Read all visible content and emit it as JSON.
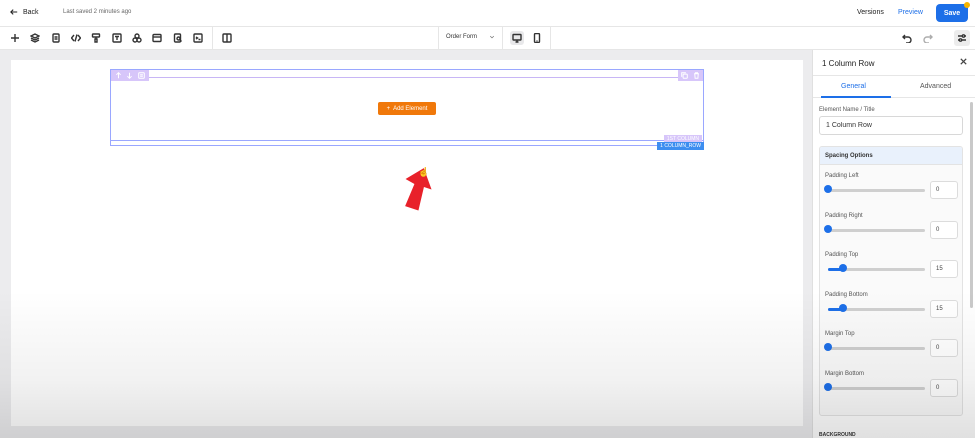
{
  "topbar": {
    "back_label": "Back",
    "saved_status": "Last saved 2 minutes ago",
    "versions_label": "Versions",
    "preview_label": "Preview",
    "save_label": "Save"
  },
  "toolbar": {
    "icons": [
      "plus-icon",
      "layers-icon",
      "forms-icon",
      "paint-roller-icon",
      "code-icon",
      "text-icon",
      "shapes-icon",
      "layout-icon",
      "search-file-icon",
      "terminal-icon",
      "columns-icon"
    ],
    "form_selector": "Order Form",
    "devices": [
      "desktop-icon",
      "mobile-icon"
    ],
    "right_icons": [
      "undo-icon",
      "redo-icon",
      "settings-sliders-icon"
    ]
  },
  "canvas": {
    "add_element_label": "Add Element",
    "column_tag": "1ST COLUMN",
    "row_tag": "1 COLUMN_ROW"
  },
  "panel": {
    "title": "1 Column Row",
    "tabs": [
      "General",
      "Advanced"
    ],
    "active_tab": "General",
    "element_name_label": "Element Name / Title",
    "element_name_value": "1 Column Row",
    "spacing_title": "Spacing Options",
    "sliders": [
      {
        "label": "Padding Left",
        "value": "0",
        "fraction": 0.0
      },
      {
        "label": "Padding Right",
        "value": "0",
        "fraction": 0.0
      },
      {
        "label": "Padding Top",
        "value": "15",
        "fraction": 0.15
      },
      {
        "label": "Padding Bottom",
        "value": "15",
        "fraction": 0.15
      },
      {
        "label": "Margin Top",
        "value": "0",
        "fraction": 0.0
      },
      {
        "label": "Margin Bottom",
        "value": "0",
        "fraction": 0.0
      }
    ],
    "background_label": "BACKGROUND"
  },
  "colors": {
    "accent": "#1d6fe8",
    "add_element": "#f0780a",
    "row_highlight": "#d7c6fa",
    "arrow": "#e8212a"
  }
}
